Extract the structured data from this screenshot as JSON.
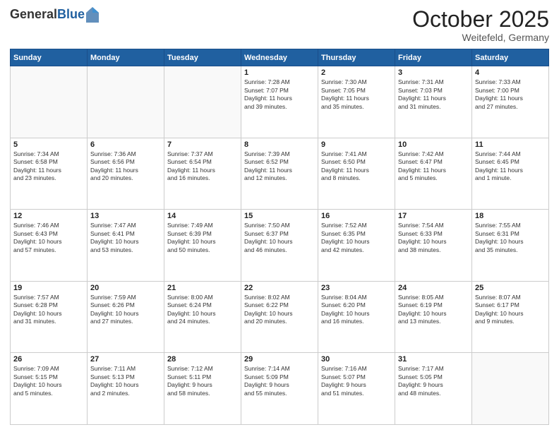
{
  "header": {
    "logo_general": "General",
    "logo_blue": "Blue",
    "month": "October 2025",
    "location": "Weitefeld, Germany"
  },
  "days_of_week": [
    "Sunday",
    "Monday",
    "Tuesday",
    "Wednesday",
    "Thursday",
    "Friday",
    "Saturday"
  ],
  "weeks": [
    [
      {
        "day": "",
        "content": ""
      },
      {
        "day": "",
        "content": ""
      },
      {
        "day": "",
        "content": ""
      },
      {
        "day": "1",
        "content": "Sunrise: 7:28 AM\nSunset: 7:07 PM\nDaylight: 11 hours\nand 39 minutes."
      },
      {
        "day": "2",
        "content": "Sunrise: 7:30 AM\nSunset: 7:05 PM\nDaylight: 11 hours\nand 35 minutes."
      },
      {
        "day": "3",
        "content": "Sunrise: 7:31 AM\nSunset: 7:03 PM\nDaylight: 11 hours\nand 31 minutes."
      },
      {
        "day": "4",
        "content": "Sunrise: 7:33 AM\nSunset: 7:00 PM\nDaylight: 11 hours\nand 27 minutes."
      }
    ],
    [
      {
        "day": "5",
        "content": "Sunrise: 7:34 AM\nSunset: 6:58 PM\nDaylight: 11 hours\nand 23 minutes."
      },
      {
        "day": "6",
        "content": "Sunrise: 7:36 AM\nSunset: 6:56 PM\nDaylight: 11 hours\nand 20 minutes."
      },
      {
        "day": "7",
        "content": "Sunrise: 7:37 AM\nSunset: 6:54 PM\nDaylight: 11 hours\nand 16 minutes."
      },
      {
        "day": "8",
        "content": "Sunrise: 7:39 AM\nSunset: 6:52 PM\nDaylight: 11 hours\nand 12 minutes."
      },
      {
        "day": "9",
        "content": "Sunrise: 7:41 AM\nSunset: 6:50 PM\nDaylight: 11 hours\nand 8 minutes."
      },
      {
        "day": "10",
        "content": "Sunrise: 7:42 AM\nSunset: 6:47 PM\nDaylight: 11 hours\nand 5 minutes."
      },
      {
        "day": "11",
        "content": "Sunrise: 7:44 AM\nSunset: 6:45 PM\nDaylight: 11 hours\nand 1 minute."
      }
    ],
    [
      {
        "day": "12",
        "content": "Sunrise: 7:46 AM\nSunset: 6:43 PM\nDaylight: 10 hours\nand 57 minutes."
      },
      {
        "day": "13",
        "content": "Sunrise: 7:47 AM\nSunset: 6:41 PM\nDaylight: 10 hours\nand 53 minutes."
      },
      {
        "day": "14",
        "content": "Sunrise: 7:49 AM\nSunset: 6:39 PM\nDaylight: 10 hours\nand 50 minutes."
      },
      {
        "day": "15",
        "content": "Sunrise: 7:50 AM\nSunset: 6:37 PM\nDaylight: 10 hours\nand 46 minutes."
      },
      {
        "day": "16",
        "content": "Sunrise: 7:52 AM\nSunset: 6:35 PM\nDaylight: 10 hours\nand 42 minutes."
      },
      {
        "day": "17",
        "content": "Sunrise: 7:54 AM\nSunset: 6:33 PM\nDaylight: 10 hours\nand 38 minutes."
      },
      {
        "day": "18",
        "content": "Sunrise: 7:55 AM\nSunset: 6:31 PM\nDaylight: 10 hours\nand 35 minutes."
      }
    ],
    [
      {
        "day": "19",
        "content": "Sunrise: 7:57 AM\nSunset: 6:28 PM\nDaylight: 10 hours\nand 31 minutes."
      },
      {
        "day": "20",
        "content": "Sunrise: 7:59 AM\nSunset: 6:26 PM\nDaylight: 10 hours\nand 27 minutes."
      },
      {
        "day": "21",
        "content": "Sunrise: 8:00 AM\nSunset: 6:24 PM\nDaylight: 10 hours\nand 24 minutes."
      },
      {
        "day": "22",
        "content": "Sunrise: 8:02 AM\nSunset: 6:22 PM\nDaylight: 10 hours\nand 20 minutes."
      },
      {
        "day": "23",
        "content": "Sunrise: 8:04 AM\nSunset: 6:20 PM\nDaylight: 10 hours\nand 16 minutes."
      },
      {
        "day": "24",
        "content": "Sunrise: 8:05 AM\nSunset: 6:19 PM\nDaylight: 10 hours\nand 13 minutes."
      },
      {
        "day": "25",
        "content": "Sunrise: 8:07 AM\nSunset: 6:17 PM\nDaylight: 10 hours\nand 9 minutes."
      }
    ],
    [
      {
        "day": "26",
        "content": "Sunrise: 7:09 AM\nSunset: 5:15 PM\nDaylight: 10 hours\nand 5 minutes."
      },
      {
        "day": "27",
        "content": "Sunrise: 7:11 AM\nSunset: 5:13 PM\nDaylight: 10 hours\nand 2 minutes."
      },
      {
        "day": "28",
        "content": "Sunrise: 7:12 AM\nSunset: 5:11 PM\nDaylight: 9 hours\nand 58 minutes."
      },
      {
        "day": "29",
        "content": "Sunrise: 7:14 AM\nSunset: 5:09 PM\nDaylight: 9 hours\nand 55 minutes."
      },
      {
        "day": "30",
        "content": "Sunrise: 7:16 AM\nSunset: 5:07 PM\nDaylight: 9 hours\nand 51 minutes."
      },
      {
        "day": "31",
        "content": "Sunrise: 7:17 AM\nSunset: 5:05 PM\nDaylight: 9 hours\nand 48 minutes."
      },
      {
        "day": "",
        "content": ""
      }
    ]
  ]
}
